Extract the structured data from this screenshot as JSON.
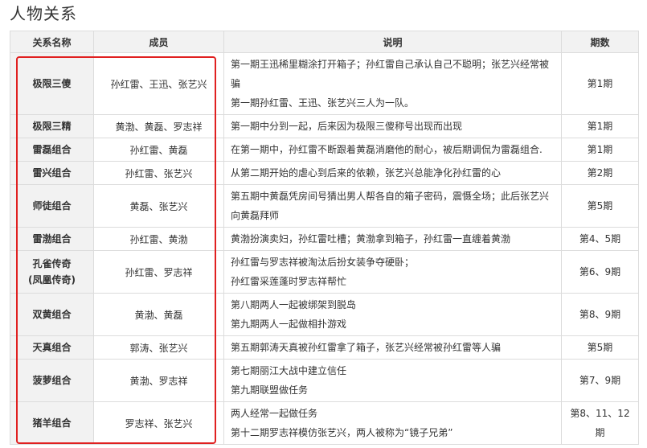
{
  "page": {
    "title": "人物关系"
  },
  "table": {
    "headers": [
      "关系名称",
      "成员",
      "说明",
      "期数"
    ],
    "rows": [
      {
        "name": [
          "极限三傻"
        ],
        "members": "孙红雷、王迅、张艺兴",
        "desc": [
          "第一期王迅稀里糊涂打开箱子；孙红雷自己承认自己不聪明；张艺兴经常被骗",
          "第一期孙红雷、王迅、张艺兴三人为一队。"
        ],
        "period": [
          "第1期"
        ]
      },
      {
        "name": [
          "极限三精"
        ],
        "members": "黄渤、黄磊、罗志祥",
        "desc": [
          "第一期中分到一起，后来因为极限三傻称号出现而出现"
        ],
        "period": [
          "第1期"
        ]
      },
      {
        "name": [
          "雷磊组合"
        ],
        "members": "孙红雷、黄磊",
        "desc": [
          "在第一期中，孙红雷不断跟着黄磊消磨他的耐心，被后期调侃为雷磊组合."
        ],
        "period": [
          "第1期"
        ]
      },
      {
        "name": [
          "雷兴组合"
        ],
        "members": "孙红雷、张艺兴",
        "desc": [
          "从第二期开始的虐心到后来的依赖，张艺兴总能净化孙红雷的心"
        ],
        "period": [
          "第2期"
        ]
      },
      {
        "name": [
          "师徒组合"
        ],
        "members": "黄磊、张艺兴",
        "desc": [
          "第五期中黄磊凭房间号猜出男人帮各自的箱子密码，震慑全场；此后张艺兴向黄磊拜师"
        ],
        "period": [
          "第5期"
        ]
      },
      {
        "name": [
          "雷渤组合"
        ],
        "members": "孙红雷、黄渤",
        "desc": [
          "黄渤扮演卖妇，孙红雷吐槽；黄渤拿到箱子，孙红雷一直缠着黄渤"
        ],
        "period": [
          "第4、5期"
        ]
      },
      {
        "name": [
          "孔雀传奇",
          "(凤凰传奇)"
        ],
        "members": "孙红雷、罗志祥",
        "desc": [
          "孙红雷与罗志祥被淘汰后扮女装争夺硬卧；",
          "孙红雷采莲蓬时罗志祥帮忙"
        ],
        "period": [
          "第6、9期"
        ]
      },
      {
        "name": [
          "双黄组合"
        ],
        "members": "黄渤、黄磊",
        "desc": [
          "第八期两人一起被绑架到脱岛",
          "第九期两人一起做相扑游戏"
        ],
        "period": [
          "第8、9期"
        ]
      },
      {
        "name": [
          "天真组合"
        ],
        "members": "郭涛、张艺兴",
        "desc": [
          "第五期郭涛天真被孙红雷拿了箱子，张艺兴经常被孙红雷等人骗"
        ],
        "period": [
          "第5期"
        ]
      },
      {
        "name": [
          "菠萝组合"
        ],
        "members": "黄渤、罗志祥",
        "desc": [
          "第七期丽江大战中建立信任",
          "第九期联盟做任务"
        ],
        "period": [
          "第7、9期"
        ]
      },
      {
        "name": [
          "猪羊组合"
        ],
        "members": "罗志祥、张艺兴",
        "desc": [
          "两人经常一起做任务",
          "第十二期罗志祥模仿张艺兴，两人被称为“镜子兄弟”"
        ],
        "period": [
          "第8、11、12",
          "期"
        ]
      }
    ]
  },
  "annotation": {
    "color": "#e02020"
  }
}
